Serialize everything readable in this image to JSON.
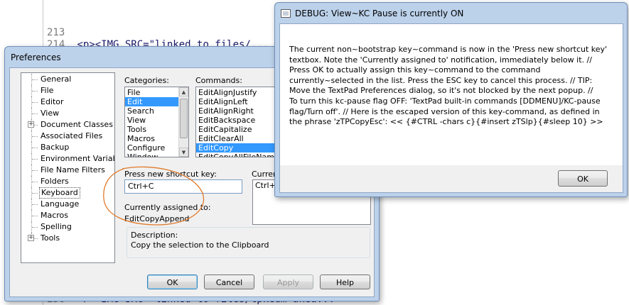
{
  "editor": {
    "lines": [
      {
        "num": "213",
        "code": ""
      },
      {
        "num": "214",
        "code": "<p><IMG SRC=\"linked to files/..."
      },
      {
        "num": "256",
        "code": "<P><IMG SRC=\"linked to files/tpkeum akeu..."
      }
    ]
  },
  "prefs": {
    "title": "Preferences",
    "tree": [
      {
        "label": "General",
        "expand": ""
      },
      {
        "label": "File",
        "expand": ""
      },
      {
        "label": "Editor",
        "expand": ""
      },
      {
        "label": "View",
        "expand": ""
      },
      {
        "label": "Document Classes",
        "expand": "+"
      },
      {
        "label": "Associated Files",
        "expand": ""
      },
      {
        "label": "Backup",
        "expand": ""
      },
      {
        "label": "Environment Variables",
        "expand": ""
      },
      {
        "label": "File Name Filters",
        "expand": ""
      },
      {
        "label": "Folders",
        "expand": ""
      },
      {
        "label": "Keyboard",
        "expand": "",
        "selected": true
      },
      {
        "label": "Language",
        "expand": ""
      },
      {
        "label": "Macros",
        "expand": ""
      },
      {
        "label": "Spelling",
        "expand": ""
      },
      {
        "label": "Tools",
        "expand": "+"
      }
    ],
    "categories_label": "Categories:",
    "categories": [
      "File",
      "Edit",
      "Search",
      "View",
      "Tools",
      "Macros",
      "Configure",
      "Window"
    ],
    "selected_category": "Edit",
    "commands_label": "Commands:",
    "commands": [
      "EditAlignJustify",
      "EditAlignLeft",
      "EditAlignRight",
      "EditBackspace",
      "EditCapitalize",
      "EditClearAll",
      "EditCopy",
      "EditCopyAllFileNames"
    ],
    "selected_command": "EditCopy",
    "press_label": "Press new shortcut key:",
    "shortcut_value": "Ctrl+C",
    "current_label": "Current",
    "current_keys": "Ctrl+Ins",
    "assigned_label": "Currently assigned to:",
    "assigned_value": "EditCopyAppend",
    "desc_label": "Description:",
    "desc_text": "Copy the selection to the Clipboard",
    "buttons": {
      "ok": "OK",
      "cancel": "Cancel",
      "apply": "Apply",
      "help": "Help"
    }
  },
  "debug": {
    "title": "DEBUG: View~KC Pause is currently ON",
    "lines": [
      "The current non~bootstrap key~command is now in the 'Press new shortcut key'",
      "textbox. Note the 'Currently assigned to' notification, immediately below it.  //",
      "Press OK to actually assign this key~command to the command",
      "currently~selected in the list. Press the ESC key to cancel this process.  //  TIP:",
      "Move the TextPad Preferences dialog, so it's not blocked by the next popup.  //",
      "To turn this kc-pause flag OFF: 'TextPad built-in commands [DDMENU]/KC-pause",
      "flag/Turn off'.  //  Here is the escaped version of this key-command, as defined in",
      "the phrase 'zTPCopyEsc':  << {#CTRL -chars c}{#insert zTSlp}{#sleep 10} >>"
    ],
    "ok": "OK"
  },
  "colors": {
    "annotation": "#e07a2a",
    "selection": "#3399ff",
    "titlebar": "#bcd1ea"
  }
}
